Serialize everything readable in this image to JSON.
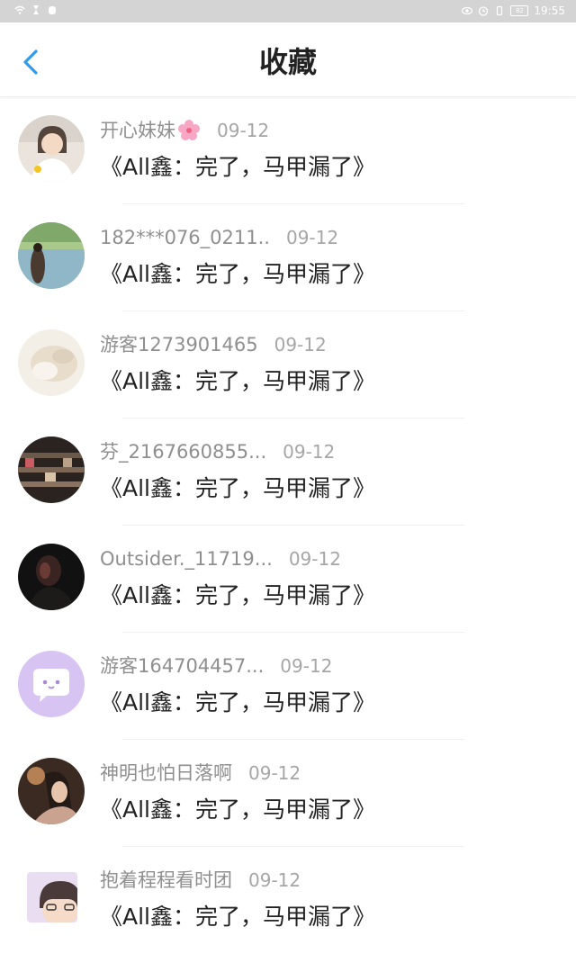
{
  "status_bar": {
    "time": "19:55",
    "battery": "82"
  },
  "header": {
    "title": "收藏"
  },
  "items": [
    {
      "username": "开心妹妹",
      "date": "09-12",
      "title": "《All鑫：完了，马甲漏了》"
    },
    {
      "username": "182***076_0211..",
      "date": "09-12",
      "title": "《All鑫：完了，马甲漏了》"
    },
    {
      "username": "游客1273901465",
      "date": "09-12",
      "title": "《All鑫：完了，马甲漏了》"
    },
    {
      "username": "芬_2167660855...",
      "date": "09-12",
      "title": "《All鑫：完了，马甲漏了》"
    },
    {
      "username": "Outsider._11719...",
      "date": "09-12",
      "title": "《All鑫：完了，马甲漏了》"
    },
    {
      "username": "游客164704457...",
      "date": "09-12",
      "title": "《All鑫：完了，马甲漏了》"
    },
    {
      "username": "神明也怕日落啊",
      "date": "09-12",
      "title": "《All鑫：完了，马甲漏了》"
    },
    {
      "username": "抱着程程看时团",
      "date": "09-12",
      "title": "《All鑫：完了，马甲漏了》"
    }
  ],
  "colors": {
    "accent": "#2f9bea",
    "status_bar_bg": "#d4d4d4"
  }
}
